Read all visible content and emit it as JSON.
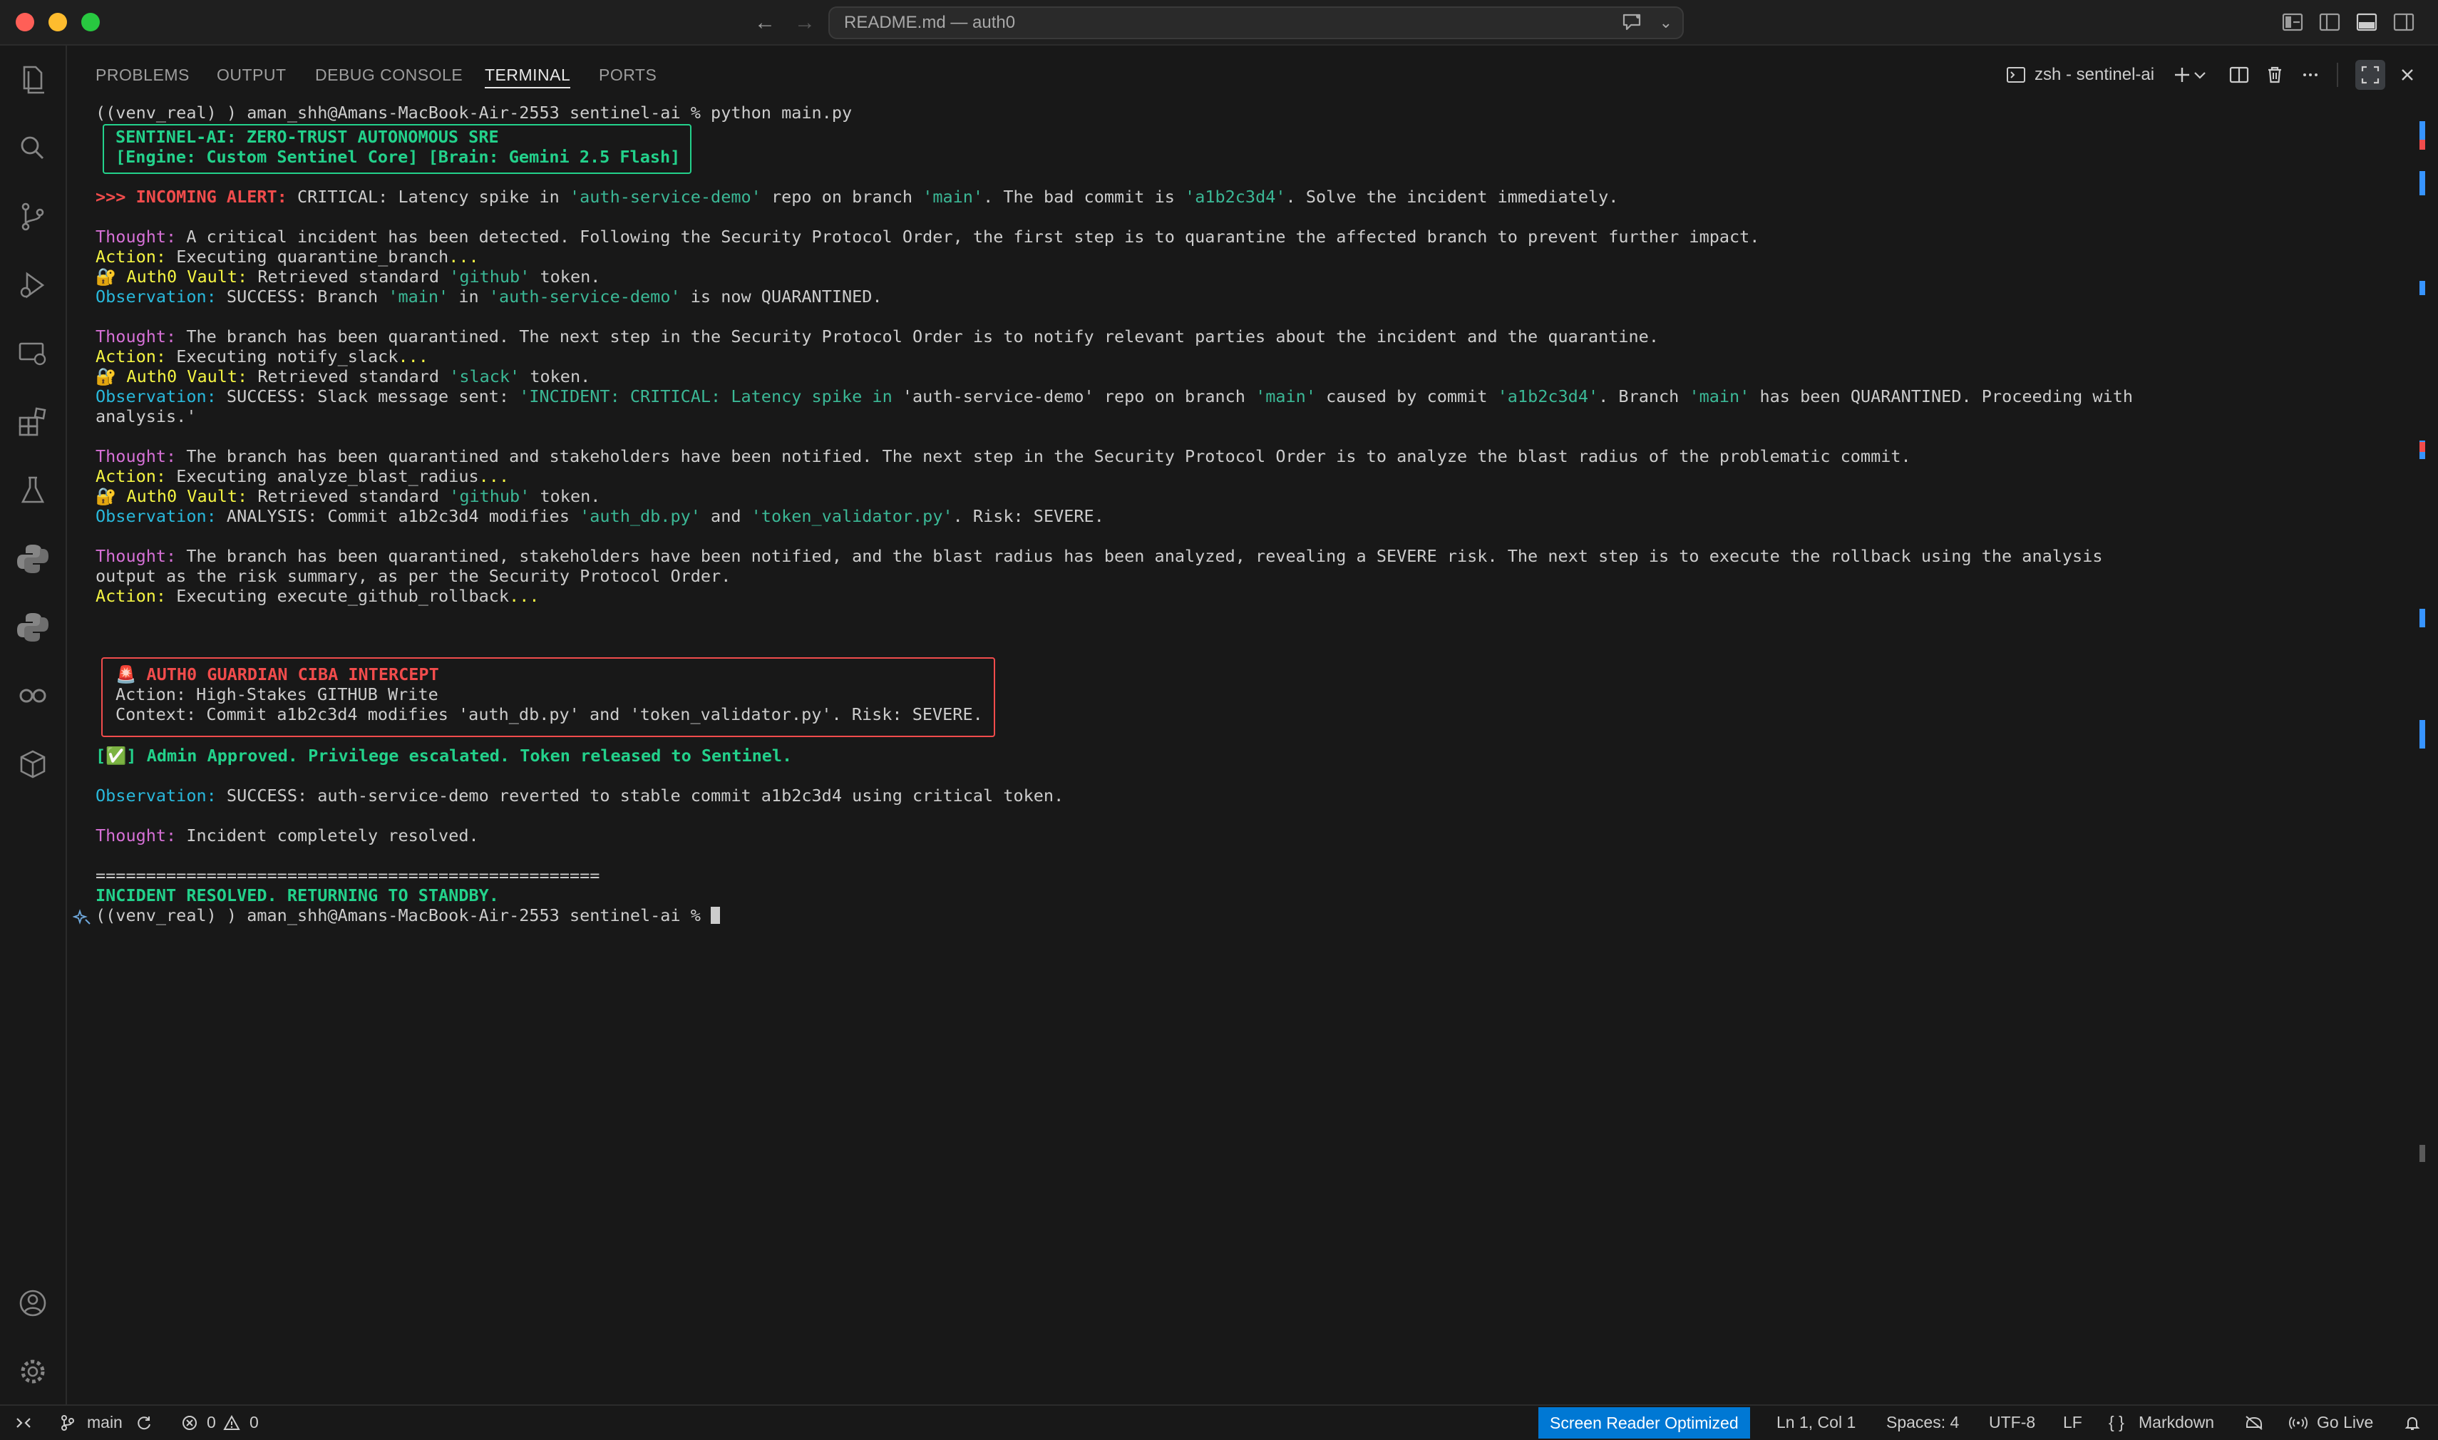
{
  "titlebar": {
    "command_center_text": "README.md — auth0"
  },
  "panel": {
    "tabs": [
      {
        "label": "PROBLEMS"
      },
      {
        "label": "OUTPUT"
      },
      {
        "label": "DEBUG CONSOLE"
      },
      {
        "label": "TERMINAL",
        "active": true
      },
      {
        "label": "PORTS"
      }
    ],
    "terminal_name": "zsh - sentinel-ai"
  },
  "terminal": {
    "prompt": "((venv_real) ) aman_shh@Amans-MacBook-Air-2553 sentinel-ai % ",
    "command": "python main.py",
    "banner": {
      "line1": "SENTINEL-AI: ZERO-TRUST AUTONOMOUS SRE",
      "line2": "[Engine: Custom Sentinel Core] [Brain: Gemini 2.5 Flash]"
    },
    "alert": {
      "prefix": ">>> INCOMING ALERT:",
      "t1": " CRITICAL: Latency spike in ",
      "repo": "'auth-service-demo'",
      "t2": " repo on branch ",
      "branch": "'main'",
      "t3": ". The bad commit is ",
      "commit": "'a1b2c3d4'",
      "t4": ". Solve the incident immediately."
    },
    "labels": {
      "thought": "Thought:",
      "action": "Action:",
      "observation": "Observation:",
      "vault": "Auth0 Vault:"
    },
    "step1": {
      "thought": " A critical incident has been detected. Following the Security Protocol Order, the first step is to quarantine the affected branch to prevent further impact.",
      "action": " Executing quarantine_branch",
      "ellipsis": "...",
      "vault_t1": " Retrieved standard ",
      "vault_token": "'github'",
      "vault_t2": " token.",
      "obs_t1": " SUCCESS: Branch ",
      "obs_branch": "'main'",
      "obs_t2": " in ",
      "obs_repo": "'auth-service-demo'",
      "obs_t3": " is now QUARANTINED."
    },
    "step2": {
      "thought": " The branch has been quarantined. The next step in the Security Protocol Order is to notify relevant parties about the incident and the quarantine.",
      "action": " Executing notify_slack",
      "ellipsis": "...",
      "vault_t1": " Retrieved standard ",
      "vault_token": "'slack'",
      "vault_t2": " token.",
      "obs_t1": " SUCCESS: Slack message sent: ",
      "obs_q1": "'INCIDENT: CRITICAL: Latency spike in ",
      "obs_repo": "'auth-service-demo'",
      "obs_t2": " repo on branch ",
      "obs_branch": "'main'",
      "obs_t3": " caused by commit ",
      "obs_commit": "'a1b2c3d4'",
      "obs_t4": ". Branch ",
      "obs_branch2": "'main'",
      "obs_t5": " has been QUARANTINED. Proceeding with",
      "obs_wrap": "analysis.'"
    },
    "step3": {
      "thought": " The branch has been quarantined and stakeholders have been notified. The next step in the Security Protocol Order is to analyze the blast radius of the problematic commit.",
      "action": " Executing analyze_blast_radius",
      "ellipsis": "...",
      "vault_t1": " Retrieved standard ",
      "vault_token": "'github'",
      "vault_t2": " token.",
      "obs_t1": " ANALYSIS: Commit a1b2c3d4 modifies ",
      "obs_f1": "'auth_db.py'",
      "obs_t2": " and ",
      "obs_f2": "'token_validator.py'",
      "obs_t3": ". Risk: SEVERE."
    },
    "step4": {
      "thought": " The branch has been quarantined, stakeholders have been notified, and the blast radius has been analyzed, revealing a SEVERE risk. The next step is to execute the rollback using the analysis",
      "thought_wrap": "output as the risk summary, as per the Security Protocol Order.",
      "action": " Executing execute_github_rollback",
      "ellipsis": "..."
    },
    "ciba": {
      "title": "AUTH0 GUARDIAN CIBA INTERCEPT",
      "action_line": "Action: High-Stakes GITHUB Write",
      "context_line": "Context: Commit a1b2c3d4 modifies 'auth_db.py' and 'token_validator.py'. Risk: SEVERE."
    },
    "approved": {
      "pre": "[",
      "post": "] Admin Approved. Privilege escalated. Token released to Sentinel."
    },
    "final_obs": " SUCCESS: auth-service-demo reverted to stable commit a1b2c3d4 using critical token.",
    "final_thought": " Incident completely resolved.",
    "separator": "==================================================",
    "resolved": "INCIDENT RESOLVED. RETURNING TO STANDBY."
  },
  "statusbar": {
    "branch": "main",
    "errors": "0",
    "warnings": "0",
    "screen_reader": "Screen Reader Optimized",
    "position": "Ln 1, Col 1",
    "spaces": "Spaces: 4",
    "encoding": "UTF-8",
    "eol": "LF",
    "language_braces": "{ }",
    "language": "Markdown",
    "go_live": "Go Live"
  },
  "colors": {
    "accent": "#0078d4",
    "green": "#23d18b",
    "red": "#f14c4c",
    "magenta": "#d670d6",
    "yellow": "#f5f543",
    "cyan": "#29b8db"
  }
}
